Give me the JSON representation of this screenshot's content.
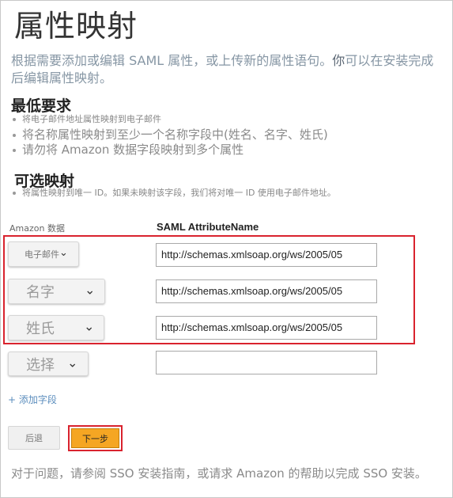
{
  "page": {
    "title": "属性映射",
    "intro_part1": "根据需要添加或编辑 SAML 属性，或上传新的属性语句。",
    "intro_strong": "你",
    "intro_part2": "可以在安装完成后编辑属性映射。"
  },
  "requirements": {
    "heading": "最低要求",
    "items": [
      "将电子邮件地址属性映射到电子邮件",
      "将名称属性映射到至少一个名称字段中(姓名、名字、姓氏)",
      "请勿将 Amazon 数据字段映射到多个属性"
    ]
  },
  "optional": {
    "heading": "可选映射",
    "items": [
      "将属性映射到唯一 ID。如果未映射该字段，我们将对唯一 ID 使用电子邮件地址。"
    ]
  },
  "table": {
    "col_left": "Amazon 数据",
    "col_right": "SAML AttributeName",
    "rows": [
      {
        "select": "电子邮件",
        "value": "http://schemas.xmlsoap.org/ws/2005/05"
      },
      {
        "select": "名字",
        "value": "http://schemas.xmlsoap.org/ws/2005/05"
      },
      {
        "select": "姓氏",
        "value": "http://schemas.xmlsoap.org/ws/2005/05"
      },
      {
        "select": "选择",
        "value": ""
      }
    ]
  },
  "add_field": "+ 添加字段",
  "buttons": {
    "back": "后退",
    "next": "下一步"
  },
  "footer": "对于问题，请参阅 SSO 安装指南，或请求 Amazon 的帮助以完成 SSO 安装。",
  "icons": {
    "chevron": "chevron-down-icon",
    "bullet": "bullet-icon"
  },
  "colors": {
    "highlight": "#d9232e",
    "next_button": "#f5a623",
    "link": "#5b8dbd"
  }
}
